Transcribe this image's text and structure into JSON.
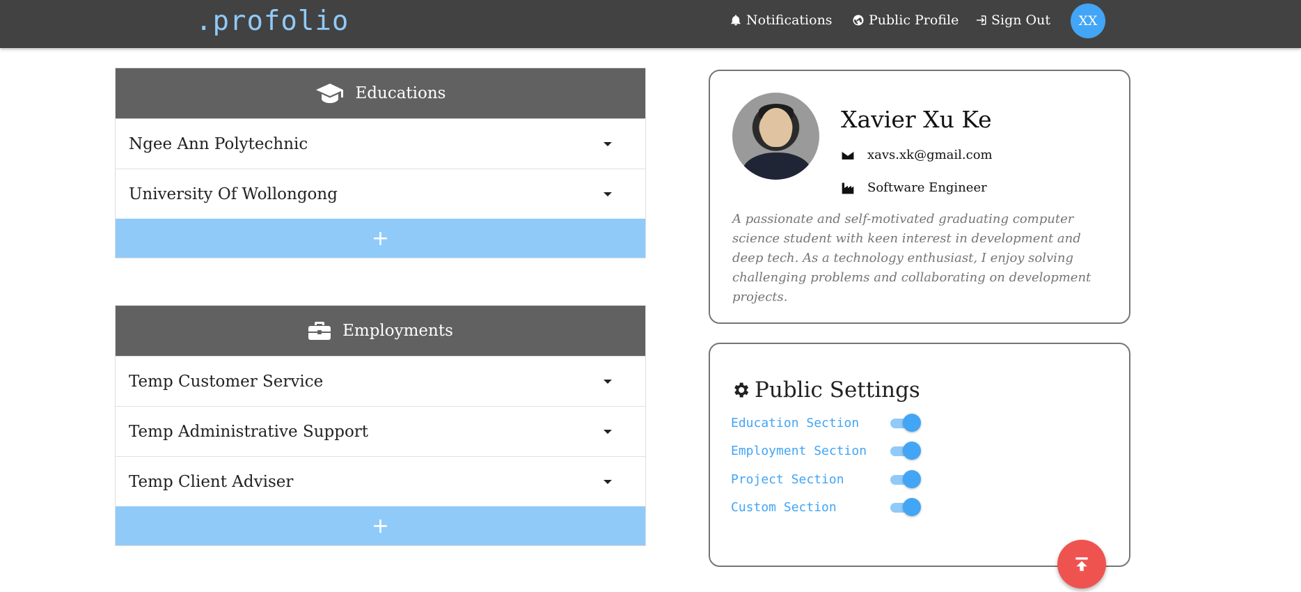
{
  "navbar": {
    "brand": ".profolio",
    "links": [
      {
        "label": "Notifications",
        "icon": "bell-icon"
      },
      {
        "label": "Public Profile",
        "icon": "globe-icon"
      },
      {
        "label": "Sign Out",
        "icon": "sign-out-icon"
      }
    ],
    "avatar_initials": "XX"
  },
  "educations": {
    "title": "Educations",
    "icon": "graduation-cap-icon",
    "items": [
      "Ngee Ann Polytechnic",
      "University Of Wollongong"
    ],
    "add_label": "+"
  },
  "employments": {
    "title": "Employments",
    "icon": "briefcase-icon",
    "items": [
      "Temp Customer Service",
      "Temp Administrative Support",
      "Temp Client Adviser"
    ],
    "add_label": "+"
  },
  "profile": {
    "name": "Xavier Xu Ke",
    "email": "xavs.xk@gmail.com",
    "occupation": "Software Engineer",
    "bio": "A passionate and self-motivated graduating computer science student with keen interest in development and deep tech. As a technology enthusiast, I enjoy solving challenging problems and collaborating on development projects."
  },
  "public_settings": {
    "title": "Public Settings",
    "toggles": [
      {
        "label": "Education Section",
        "on": true
      },
      {
        "label": "Employment Section",
        "on": true
      },
      {
        "label": "Project Section",
        "on": true
      },
      {
        "label": "Custom Section",
        "on": true
      }
    ]
  },
  "colors": {
    "navbar": "#424242",
    "brand": "#90caf9",
    "accent": "#42a5f5",
    "panel_header": "#616161",
    "add_row": "#90caf9",
    "fab": "#ef5350"
  }
}
